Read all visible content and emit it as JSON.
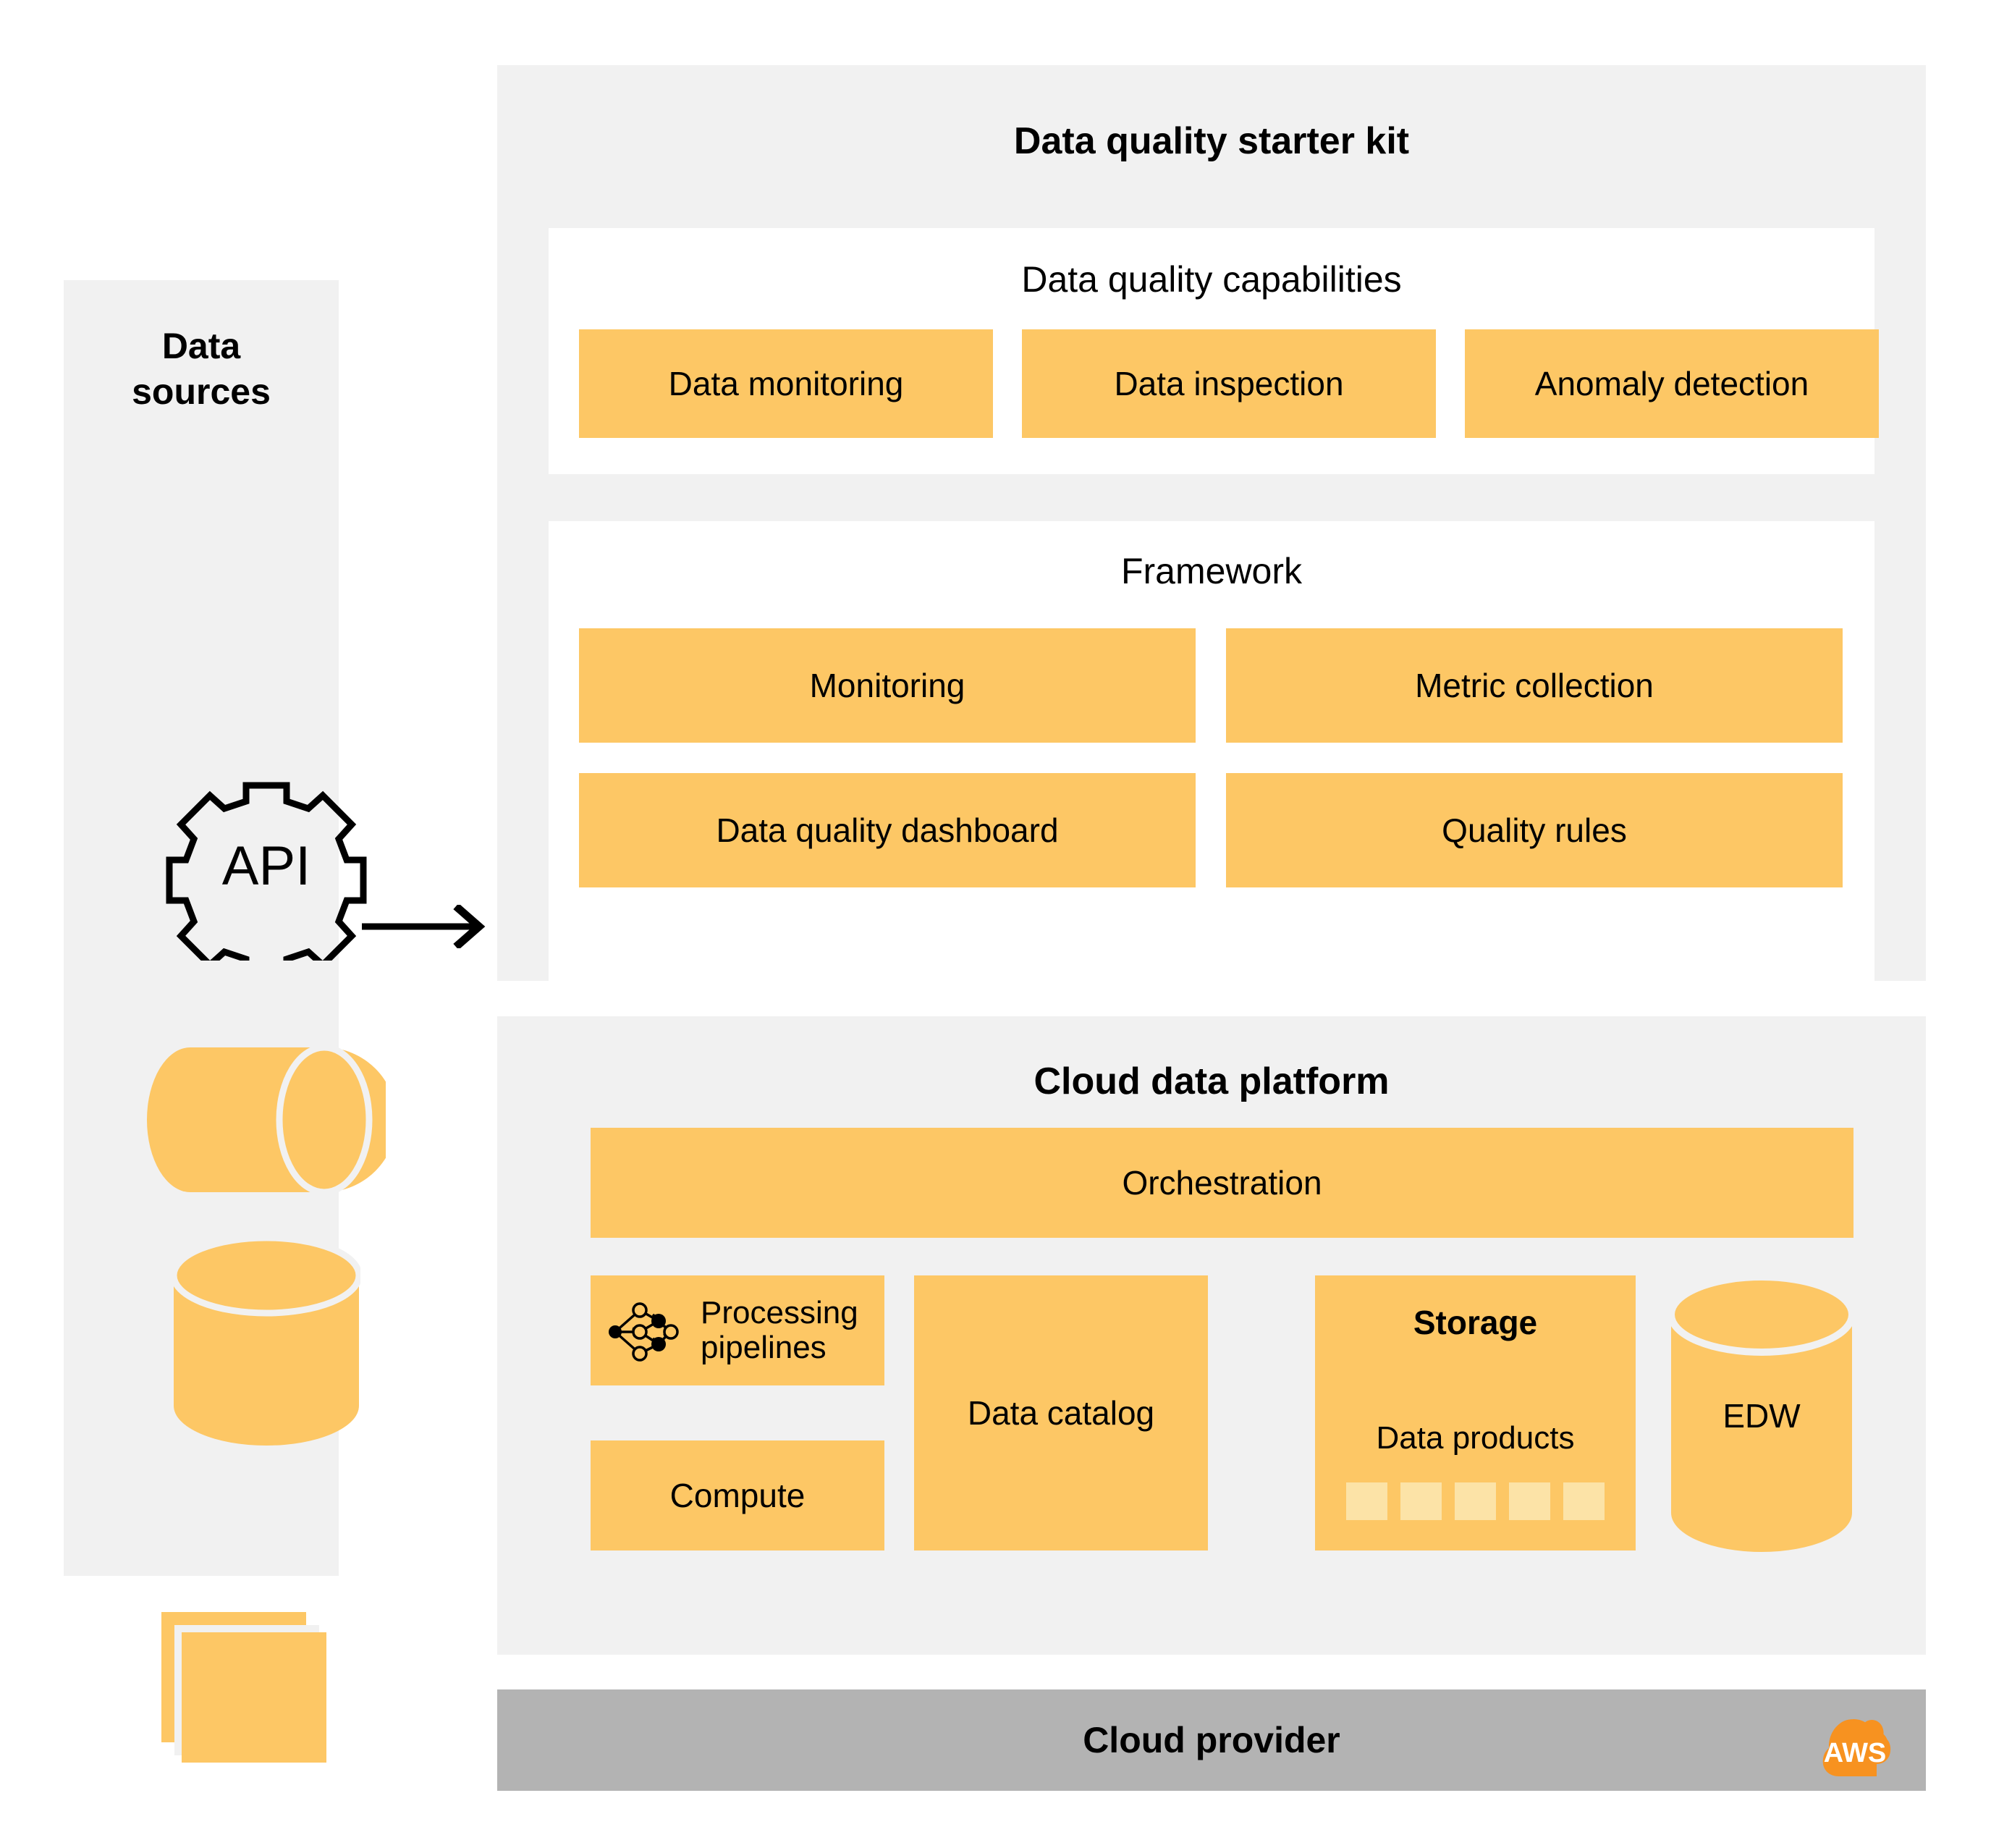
{
  "diagram": {
    "data_sources": {
      "title": "Data\nsources",
      "icons": [
        {
          "name": "api-gear-icon",
          "label": "API"
        },
        {
          "name": "database-cylinder-horizontal-icon",
          "label": ""
        },
        {
          "name": "database-cylinder-vertical-icon",
          "label": ""
        },
        {
          "name": "files-stack-icon",
          "label": ""
        }
      ]
    },
    "flow_arrow": {
      "name": "flow-arrow-right",
      "direction": "right"
    },
    "starter_kit": {
      "title": "Data quality starter kit",
      "capabilities": {
        "title": "Data quality capabilities",
        "items": [
          "Data monitoring",
          "Data inspection",
          "Anomaly detection"
        ]
      },
      "framework": {
        "title": "Framework",
        "items": [
          "Monitoring",
          "Metric collection",
          "Data quality dashboard",
          "Quality rules"
        ]
      }
    },
    "cloud_data_platform": {
      "title": "Cloud data platform",
      "orchestration": "Orchestration",
      "processing_pipelines": "Processing\npipelines",
      "compute": "Compute",
      "data_catalog": "Data catalog",
      "storage": {
        "title": "Storage",
        "data_products_label": "Data products",
        "data_products_count": 5
      },
      "edw": "EDW"
    },
    "cloud_provider": {
      "title": "Cloud provider",
      "logo_label": "AWS",
      "logo_name": "aws-cloud-logo"
    },
    "colors": {
      "orange": "#FDC765",
      "light_orange": "#FCE3A7",
      "panel_gray": "#F1F1F1",
      "provider_gray": "#B3B3B3",
      "aws_orange": "#F79220",
      "white": "#FFFFFF",
      "text": "#000000"
    }
  }
}
